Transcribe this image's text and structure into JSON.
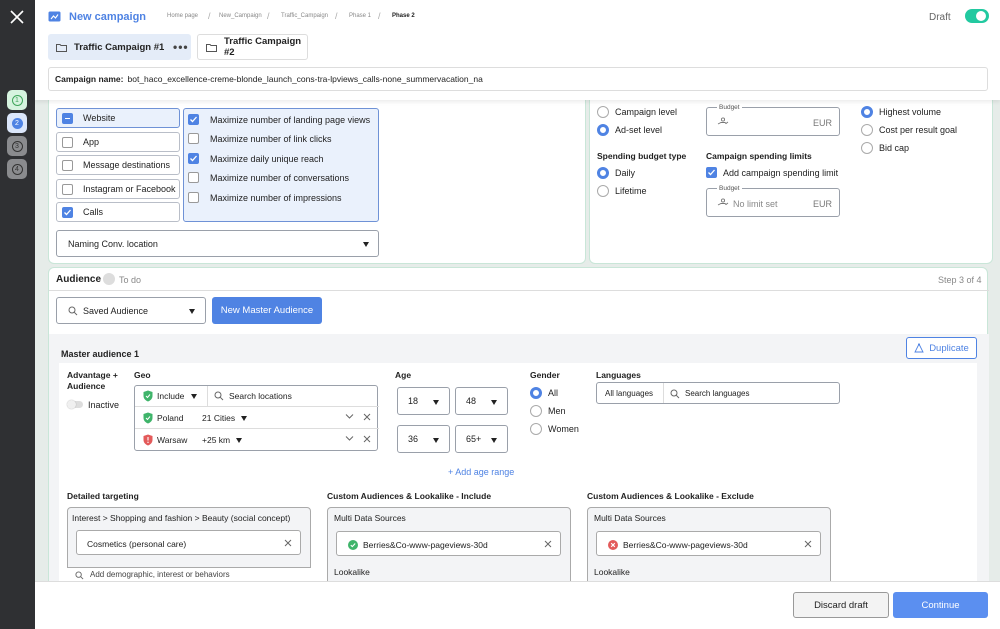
{
  "header": {
    "title": "New campaign",
    "breadcrumbs": [
      "Home page",
      "New_Campaign",
      "Traffic_Campaign",
      "Phase 1",
      "Phase 2"
    ],
    "status": "Draft",
    "tabs": [
      {
        "label": "Traffic Campaign #1"
      },
      {
        "label": "Traffic Campaign #2"
      }
    ],
    "campaign_name_label": "Campaign name:",
    "campaign_name_value": "bot_haco_excellence-creme-blonde_launch_cons-tra-lpviews_calls-none_summervacation_na"
  },
  "rail": {
    "steps": [
      "1",
      "2",
      "3",
      "4"
    ]
  },
  "destinations": {
    "items": [
      {
        "label": "Website",
        "state": "partial"
      },
      {
        "label": "App",
        "state": "off"
      },
      {
        "label": "Message destinations",
        "state": "off"
      },
      {
        "label": "Instagram or Facebook",
        "state": "off"
      },
      {
        "label": "Calls",
        "state": "on"
      }
    ],
    "goals": [
      {
        "label": "Maximize number of landing page views",
        "checked": true
      },
      {
        "label": "Maximize number of link clicks",
        "checked": false
      },
      {
        "label": "Maximize daily unique reach",
        "checked": true
      },
      {
        "label": "Maximize number of conversations",
        "checked": false
      },
      {
        "label": "Maximize number of impressions",
        "checked": false
      }
    ],
    "naming_select": "Naming Conv. location"
  },
  "budget": {
    "level_options": [
      "Campaign level",
      "Ad-set level"
    ],
    "budget_label": "Budget",
    "currency": "EUR",
    "bid_options": [
      "Highest volume",
      "Cost per result goal",
      "Bid cap"
    ],
    "spending_type_label": "Spending budget type",
    "spending_type_options": [
      "Daily",
      "Lifetime"
    ],
    "limits_label": "Campaign spending limits",
    "limits_checkbox": "Add campaign spending limit",
    "limit_budget_label": "Budget",
    "limit_placeholder": "No limit set",
    "limit_currency": "EUR"
  },
  "audience": {
    "title": "Audience",
    "status": "To do",
    "step": "Step 3 of 4",
    "saved_select": "Saved Audience",
    "new_master_button": "New Master Audience",
    "master_title": "Master audience 1",
    "duplicate_button": "Duplicate",
    "advantage_label": "Advantage + Audience",
    "advantage_state": "Inactive",
    "geo_label": "Geo",
    "geo_include": "Include",
    "geo_search_placeholder": "Search locations",
    "geo_rows": [
      {
        "country": "Poland",
        "detail": "21 Cities"
      },
      {
        "country": "Warsaw",
        "detail": "+25 km"
      }
    ],
    "age_label": "Age",
    "age_ranges": [
      [
        "18",
        "48"
      ],
      [
        "36",
        "65+"
      ]
    ],
    "add_age_range": "+ Add age range",
    "gender_label": "Gender",
    "gender_options": [
      "All",
      "Men",
      "Women"
    ],
    "languages_label": "Languages",
    "languages_all": "All languages",
    "languages_search": "Search languages",
    "detailed_label": "Detailed targeting",
    "detailed_path": "Interest > Shopping and fashion > Beauty (social concept)",
    "detailed_chip": "Cosmetics (personal care)",
    "detailed_add": "Add demographic, interest or behaviors",
    "include_label": "Custom Audiences & Lookalike - Include",
    "include_sources": "Multi Data Sources",
    "include_chip": "Berries&Co-www-pageviews-30d",
    "include_lookalike": "Lookalike",
    "exclude_label": "Custom Audiences & Lookalike - Exclude",
    "exclude_sources": "Multi Data Sources",
    "exclude_chip": "Berries&Co-www-pageviews-30d",
    "exclude_lookalike": "Lookalike"
  },
  "footer": {
    "discard": "Discard draft",
    "continue": "Continue"
  },
  "colors": {
    "accent": "#4f83e3",
    "toggle": "#22c9a0",
    "rail": "#2f3033",
    "panel_border": "#c9e6d8"
  }
}
